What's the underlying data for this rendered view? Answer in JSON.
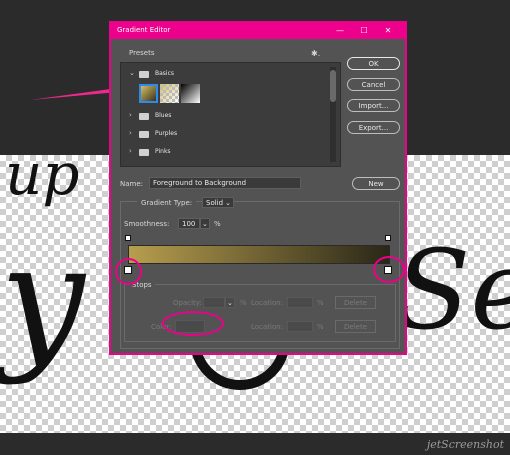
{
  "dialog": {
    "title": "Gradient Editor",
    "window_controls": {
      "minimize": "—",
      "maximize": "☐",
      "close": "✕"
    },
    "presets_label": "Presets",
    "presets_gear": "✱.",
    "folders": [
      {
        "label": "Basics",
        "expanded": true
      },
      {
        "label": "Blues",
        "expanded": false
      },
      {
        "label": "Purples",
        "expanded": false
      },
      {
        "label": "Pinks",
        "expanded": false
      }
    ],
    "buttons": {
      "ok": "OK",
      "cancel": "Cancel",
      "import": "Import...",
      "export": "Export...",
      "new": "New"
    },
    "name_label": "Name:",
    "name_value": "Foreground to Background",
    "gradient_type_label": "Gradient Type:",
    "gradient_type_value": "Solid",
    "smoothness_label": "Smoothness:",
    "smoothness_value": "100",
    "percent": "%",
    "stops_label": "Stops",
    "opacity_label": "Opacity:",
    "color_label": "Color:",
    "location_label": "Location:",
    "delete_label": "Delete",
    "gradient_colors": {
      "start": "#b79e4e",
      "end": "#2a2718"
    }
  },
  "canvas_text": {
    "left_word": "up",
    "big_letter": "y",
    "right_text": "Se"
  },
  "watermark": "jetScreenshot",
  "accent_color": "#ec008c"
}
